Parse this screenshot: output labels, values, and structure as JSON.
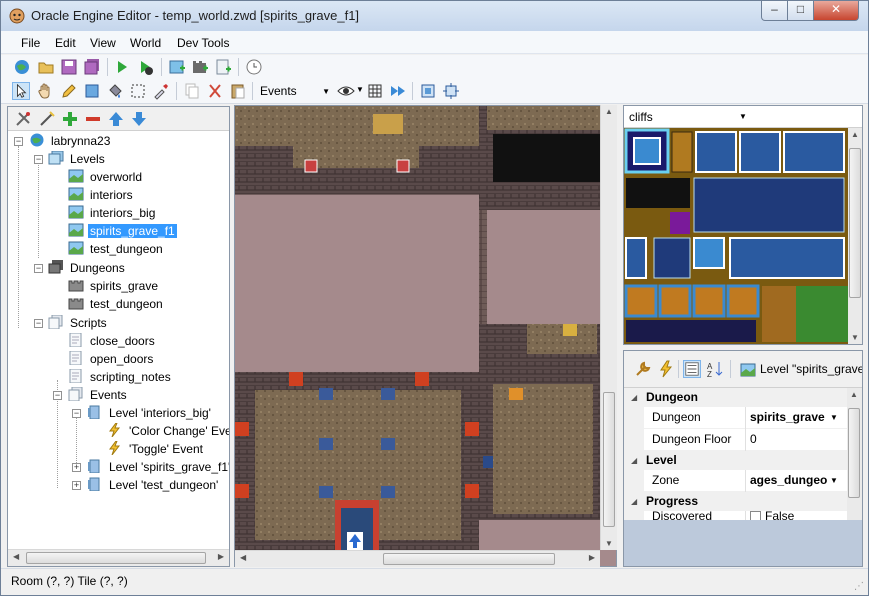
{
  "window": {
    "title": "Oracle Engine Editor - temp_world.zwd [spirits_grave_f1]",
    "min": "–",
    "max": "□",
    "close": "✕"
  },
  "menu": [
    "File",
    "Edit",
    "View",
    "World",
    "Dev Tools"
  ],
  "toolbar": {
    "layer_select": "Events"
  },
  "tree": {
    "root": "labrynna23",
    "levels_label": "Levels",
    "levels": [
      "overworld",
      "interiors",
      "interiors_big",
      "spirits_grave_f1",
      "test_dungeon"
    ],
    "dungeons_label": "Dungeons",
    "dungeons": [
      "spirits_grave",
      "test_dungeon"
    ],
    "scripts_label": "Scripts",
    "scripts": [
      "close_doors",
      "open_doors",
      "scripting_notes"
    ],
    "events_label": "Events",
    "event_groups": [
      "Level 'interiors_big'",
      "Level 'spirits_grave_f1'",
      "Level 'test_dungeon'"
    ],
    "event_items": [
      "'Color Change' Eve",
      "'Toggle' Event"
    ]
  },
  "tileset": {
    "selected": "cliffs"
  },
  "properties": {
    "title": "Level \"spirits_grave",
    "categories": [
      "Dungeon",
      "Level",
      "Progress"
    ],
    "rows": {
      "dungeon_name": "Dungeon",
      "dungeon_value": "spirits_grave",
      "floor_name": "Dungeon Floor",
      "floor_value": "0",
      "zone_name": "Zone",
      "zone_value": "ages_dungeo",
      "discovered_name": "Discovered",
      "discovered_value": "False"
    }
  },
  "status": {
    "text": "Room (?, ?) Tile (?, ?)"
  }
}
